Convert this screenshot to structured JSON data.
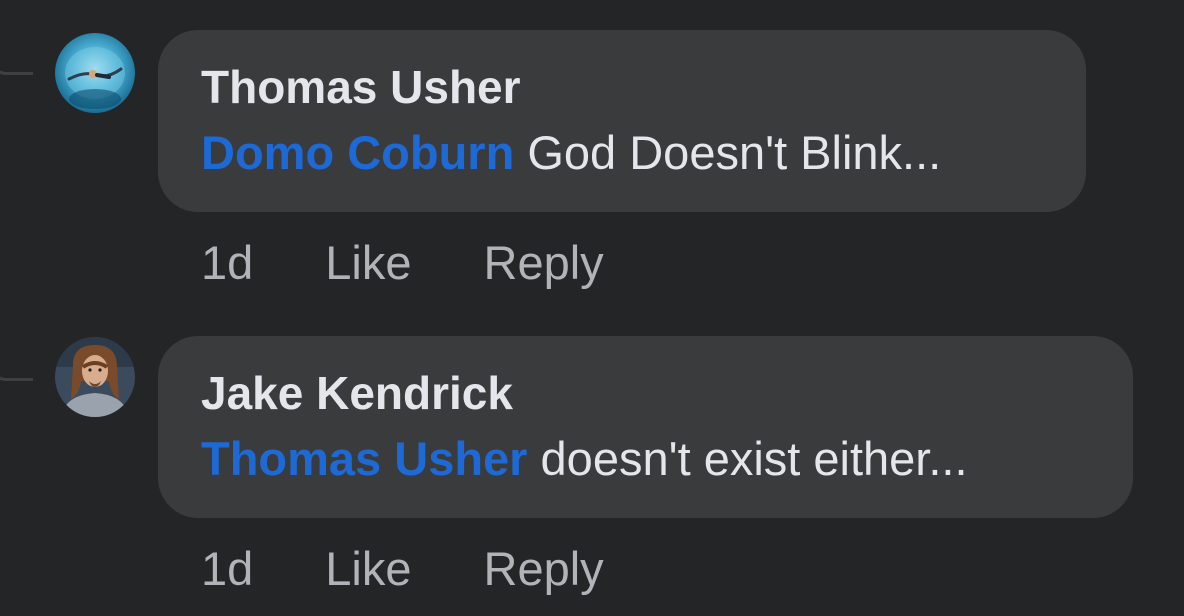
{
  "comments": [
    {
      "author": "Thomas Usher",
      "mention": "Domo Coburn",
      "text": " God Doesn't Blink...",
      "time": "1d",
      "like_label": "Like",
      "reply_label": "Reply"
    },
    {
      "author": "Jake Kendrick",
      "mention": "Thomas Usher",
      "text": " doesn't exist either...",
      "time": "1d",
      "like_label": "Like",
      "reply_label": "Reply"
    }
  ],
  "colors": {
    "background": "#242526",
    "bubble": "#3a3b3c",
    "mention": "#1d6ad6",
    "primary_text": "#e4e6eb",
    "secondary_text": "#b0b3b8"
  }
}
